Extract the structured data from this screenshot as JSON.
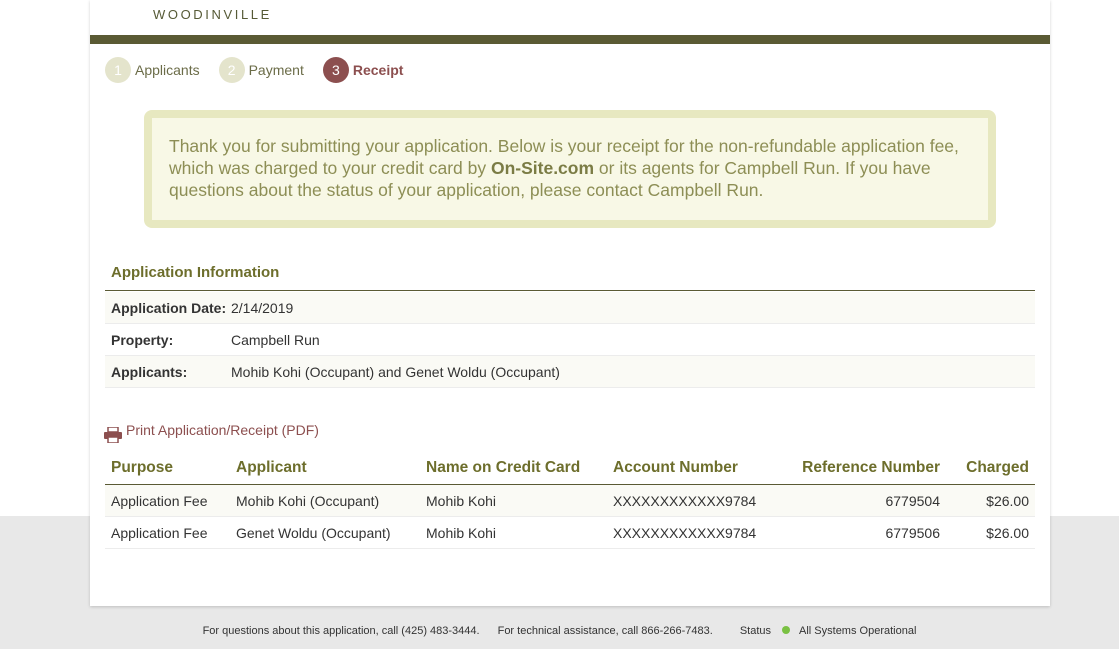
{
  "header": {
    "brand": "WOODINVILLE"
  },
  "steps": [
    {
      "num": "1",
      "label": "Applicants"
    },
    {
      "num": "2",
      "label": "Payment"
    },
    {
      "num": "3",
      "label": "Receipt"
    }
  ],
  "notice": {
    "text_before": "Thank you for submitting your application. Below is your receipt for the non-refundable application fee, which was charged to your credit card by ",
    "company": "On-Site.com",
    "text_after": " or its agents for Campbell Run. If you have questions about the status of your application, please contact Campbell Run."
  },
  "application_info": {
    "title": "Application Information",
    "rows": [
      {
        "label": "Application Date:",
        "value": "2/14/2019"
      },
      {
        "label": "Property:",
        "value": "Campbell Run"
      },
      {
        "label": "Applicants:",
        "value": "Mohib Kohi (Occupant) and Genet Woldu (Occupant)"
      }
    ]
  },
  "print_link": {
    "label": "Print Application/Receipt (PDF)",
    "icon": "printer-icon"
  },
  "charges": {
    "headers": [
      "Purpose",
      "Applicant",
      "Name on Credit Card",
      "Account Number",
      "Reference Number",
      "Charged"
    ],
    "rows": [
      [
        "Application Fee",
        "Mohib Kohi (Occupant)",
        "Mohib Kohi",
        "XXXXXXXXXXXX9784",
        "6779504",
        "$26.00"
      ],
      [
        "Application Fee",
        "Genet Woldu (Occupant)",
        "Mohib Kohi",
        "XXXXXXXXXXXX9784",
        "6779506",
        "$26.00"
      ]
    ]
  },
  "footer": {
    "questions": "For questions about this application, call (425) 483-3444.",
    "technical": "For technical assistance, call 866-266-7483.",
    "status_label": "Status",
    "status_text": "All Systems Operational",
    "status_color": "#7ac143"
  },
  "colors": {
    "accent": "#5a5a34",
    "receipt_step": "#8c4f4f",
    "notice_bg": "#e7e8c0"
  }
}
